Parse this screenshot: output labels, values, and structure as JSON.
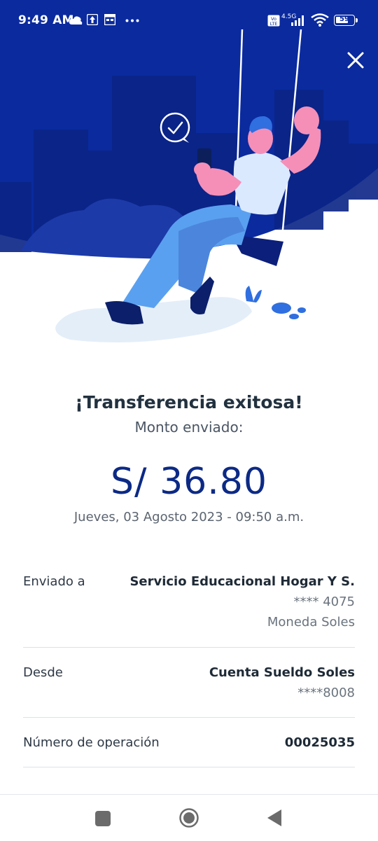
{
  "status": {
    "time": "9:49 AM",
    "network": "4.5G",
    "battery": "59",
    "icons": [
      "cloud-icon",
      "upload-icon",
      "calendar-icon",
      "more-icon",
      "volte-icon",
      "signal-icon",
      "wifi-icon",
      "battery-icon"
    ]
  },
  "header": {
    "close_icon": "close-icon",
    "colors": {
      "dark_blue": "#0a2a9e",
      "mid_blue": "#0d2480",
      "skin": "#f58fb8"
    }
  },
  "message": {
    "title": "¡Transferencia exitosa!",
    "amount_label": "Monto enviado:",
    "amount": "S/ 36.80",
    "datetime": "Jueves, 03 Agosto 2023 - 09:50 a.m."
  },
  "details": {
    "to": {
      "label": "Enviado a",
      "name": "Servicio Educacional Hogar Y S.",
      "account": "**** 4075",
      "currency": "Moneda Soles"
    },
    "from": {
      "label": "Desde",
      "name": "Cuenta Sueldo Soles",
      "account": "****8008"
    },
    "operation": {
      "label": "Número de operación",
      "number": "00025035"
    }
  },
  "navbar": {
    "icons": [
      "recents-square-icon",
      "home-circle-icon",
      "back-triangle-icon"
    ]
  }
}
